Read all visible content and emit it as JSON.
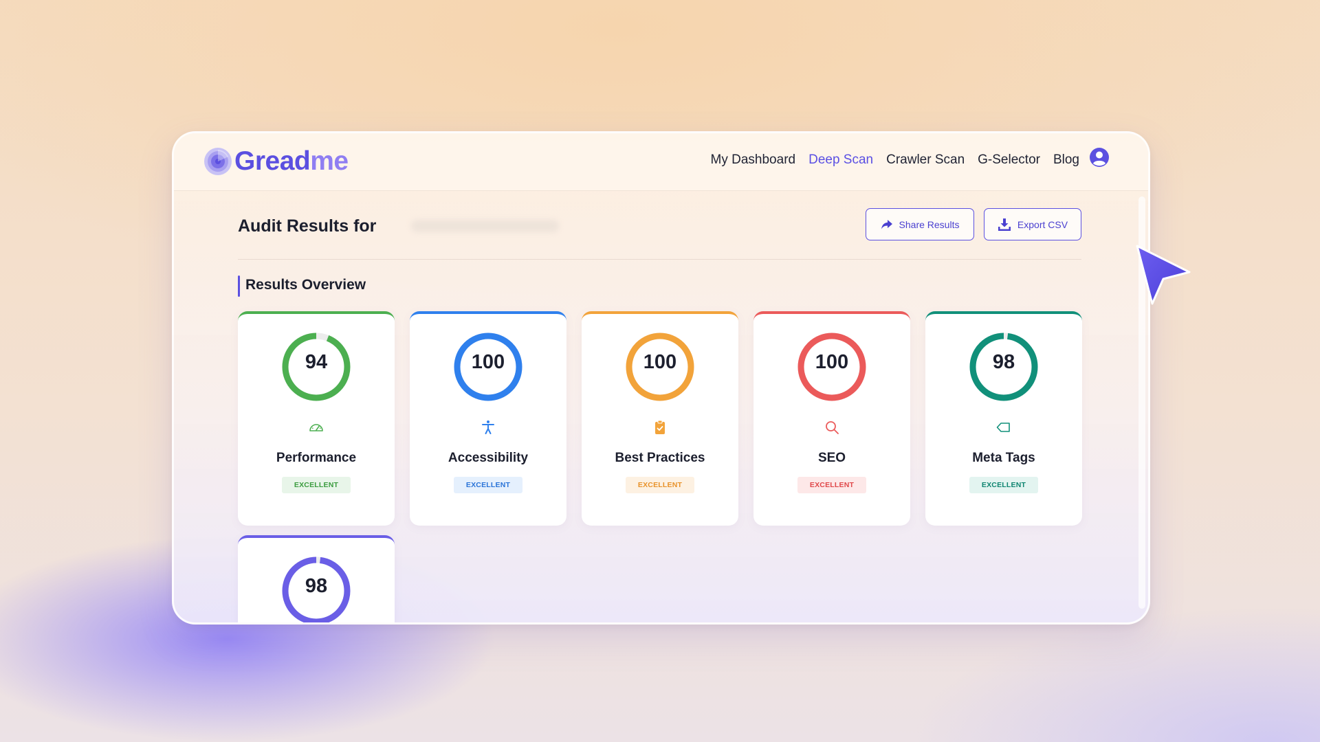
{
  "app": {
    "logo_part1": "Gread",
    "logo_part2": "me"
  },
  "nav": {
    "items": [
      {
        "label": "My Dashboard",
        "active": false
      },
      {
        "label": "Deep Scan",
        "active": true
      },
      {
        "label": "Crawler Scan",
        "active": false
      },
      {
        "label": "G-Selector",
        "active": false
      },
      {
        "label": "Blog",
        "active": false
      }
    ],
    "avatar_icon": "user-circle-icon"
  },
  "page": {
    "title": "Audit Results for",
    "share_label": "Share Results",
    "export_label": "Export CSV",
    "section_title": "Results Overview"
  },
  "results": [
    {
      "score": "94",
      "score_value": 94,
      "label": "Performance",
      "status": "EXCELLENT",
      "color": "#4caf50",
      "badge_bg": "#e8f5e9",
      "badge_color": "#3b9c3f",
      "icon": "speedometer-icon"
    },
    {
      "score": "100",
      "score_value": 100,
      "label": "Accessibility",
      "status": "EXCELLENT",
      "color": "#2f80ed",
      "badge_bg": "#e5f0fd",
      "badge_color": "#2b74d8",
      "icon": "accessibility-icon"
    },
    {
      "score": "100",
      "score_value": 100,
      "label": "Best Practices",
      "status": "EXCELLENT",
      "color": "#f2a33a",
      "badge_bg": "#fdf1e2",
      "badge_color": "#e8922a",
      "icon": "clipboard-check-icon"
    },
    {
      "score": "100",
      "score_value": 100,
      "label": "SEO",
      "status": "EXCELLENT",
      "color": "#eb5a5a",
      "badge_bg": "#fde8e8",
      "badge_color": "#e0484a",
      "icon": "search-icon"
    },
    {
      "score": "98",
      "score_value": 98,
      "label": "Meta Tags",
      "status": "EXCELLENT",
      "color": "#11907a",
      "badge_bg": "#e3f4f0",
      "badge_color": "#0f8570",
      "icon": "tag-icon"
    },
    {
      "score": "98",
      "score_value": 98,
      "label": "",
      "status": "",
      "color": "#6a5ee6",
      "badge_bg": "",
      "badge_color": "",
      "icon": ""
    }
  ]
}
